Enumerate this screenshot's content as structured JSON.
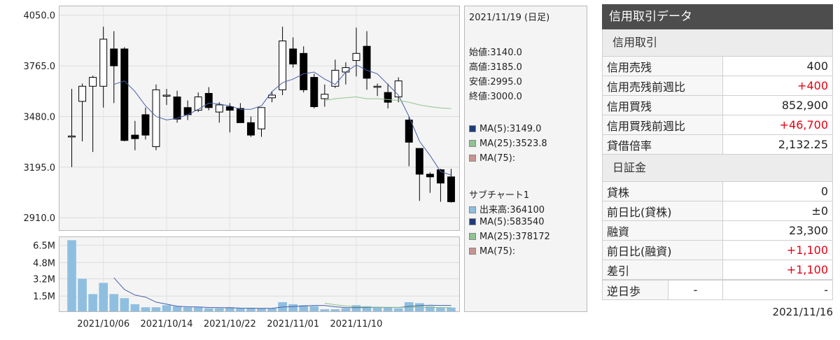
{
  "chart_data": [
    {
      "type": "candlestick",
      "panel": "price",
      "ylim": [
        2840,
        4100
      ],
      "yticks": [
        2910.0,
        3195.0,
        3480.0,
        3765.0,
        4050.0
      ],
      "ytick_labels": [
        "2910.0",
        "3195.0",
        "3480.0",
        "3765.0",
        "4050.0"
      ],
      "x_labels": [
        "2021/10/06",
        "2021/10/14",
        "2021/10/22",
        "2021/11/01",
        "2021/11/10"
      ],
      "x_label_indices": [
        3,
        9,
        15,
        21,
        27
      ],
      "candles": [
        {
          "o": 3370,
          "h": 3635,
          "l": 3195,
          "c": 3370
        },
        {
          "o": 3565,
          "h": 3665,
          "l": 3340,
          "c": 3650
        },
        {
          "o": 3650,
          "h": 3710,
          "l": 3280,
          "c": 3700
        },
        {
          "o": 3650,
          "h": 3985,
          "l": 3530,
          "c": 3915
        },
        {
          "o": 3860,
          "h": 3960,
          "l": 3555,
          "c": 3765
        },
        {
          "o": 3860,
          "h": 3870,
          "l": 3340,
          "c": 3345
        },
        {
          "o": 3375,
          "h": 3455,
          "l": 3290,
          "c": 3355
        },
        {
          "o": 3490,
          "h": 3530,
          "l": 3350,
          "c": 3375
        },
        {
          "o": 3310,
          "h": 3660,
          "l": 3290,
          "c": 3630
        },
        {
          "o": 3600,
          "h": 3635,
          "l": 3545,
          "c": 3600
        },
        {
          "o": 3590,
          "h": 3625,
          "l": 3445,
          "c": 3465
        },
        {
          "o": 3530,
          "h": 3570,
          "l": 3460,
          "c": 3490
        },
        {
          "o": 3515,
          "h": 3615,
          "l": 3505,
          "c": 3590
        },
        {
          "o": 3610,
          "h": 3645,
          "l": 3515,
          "c": 3530
        },
        {
          "o": 3505,
          "h": 3560,
          "l": 3445,
          "c": 3545
        },
        {
          "o": 3535,
          "h": 3555,
          "l": 3390,
          "c": 3515
        },
        {
          "o": 3525,
          "h": 3555,
          "l": 3450,
          "c": 3445
        },
        {
          "o": 3445,
          "h": 3480,
          "l": 3365,
          "c": 3375
        },
        {
          "o": 3410,
          "h": 3490,
          "l": 3365,
          "c": 3530
        },
        {
          "o": 3585,
          "h": 3620,
          "l": 3560,
          "c": 3600
        },
        {
          "o": 3630,
          "h": 3985,
          "l": 3600,
          "c": 3905
        },
        {
          "o": 3860,
          "h": 3925,
          "l": 3755,
          "c": 3775
        },
        {
          "o": 3835,
          "h": 3875,
          "l": 3615,
          "c": 3630
        },
        {
          "o": 3700,
          "h": 3720,
          "l": 3525,
          "c": 3535
        },
        {
          "o": 3580,
          "h": 3660,
          "l": 3535,
          "c": 3605
        },
        {
          "o": 3650,
          "h": 3800,
          "l": 3640,
          "c": 3740
        },
        {
          "o": 3730,
          "h": 3785,
          "l": 3660,
          "c": 3755
        },
        {
          "o": 3795,
          "h": 3980,
          "l": 3705,
          "c": 3835
        },
        {
          "o": 3875,
          "h": 3960,
          "l": 3630,
          "c": 3695
        },
        {
          "o": 3650,
          "h": 3665,
          "l": 3595,
          "c": 3650
        },
        {
          "o": 3615,
          "h": 3665,
          "l": 3525,
          "c": 3560
        },
        {
          "o": 3590,
          "h": 3700,
          "l": 3560,
          "c": 3680
        },
        {
          "o": 3460,
          "h": 3480,
          "l": 3200,
          "c": 3335
        },
        {
          "o": 3300,
          "h": 3300,
          "l": 3005,
          "c": 3155
        },
        {
          "o": 3155,
          "h": 3165,
          "l": 3050,
          "c": 3140
        },
        {
          "o": 3180,
          "h": 3185,
          "l": 3000,
          "c": 3105
        },
        {
          "o": 3140,
          "h": 3185,
          "l": 2995,
          "c": 3000
        }
      ],
      "ma5": [
        null,
        null,
        null,
        null,
        3660,
        3680,
        3620,
        3540,
        3480,
        3460,
        3470,
        3490,
        3520,
        3555,
        3550,
        3540,
        3520,
        3520,
        3540,
        3620,
        3670,
        3690,
        3720,
        3730,
        3690,
        3660,
        3730,
        3770,
        3740,
        3720,
        3660,
        3600,
        3480,
        3340,
        3260,
        3170,
        3150
      ],
      "ma25": [
        null,
        null,
        null,
        null,
        null,
        null,
        null,
        null,
        null,
        null,
        null,
        null,
        null,
        null,
        null,
        null,
        null,
        null,
        null,
        null,
        null,
        null,
        null,
        null,
        3570,
        3580,
        3585,
        3590,
        3580,
        3580,
        3575,
        3570,
        3560,
        3545,
        3535,
        3528,
        3524
      ],
      "legend": [
        {
          "label": "MA(5):3149.0",
          "color": "#1f3b7a"
        },
        {
          "label": "MA(25):3523.8",
          "color": "#8fc490"
        },
        {
          "label": "MA(75):",
          "color": "#c89390"
        }
      ]
    },
    {
      "type": "bar",
      "panel": "volume",
      "ylim": [
        0,
        7300000
      ],
      "yticks": [
        1500000,
        3200000,
        4800000,
        6500000
      ],
      "ytick_labels": [
        "1.5M",
        "3.2M",
        "4.8M",
        "6.5M"
      ],
      "values": [
        7000000,
        3200000,
        1700000,
        2800000,
        1700000,
        1300000,
        700000,
        400000,
        400000,
        600000,
        500000,
        400000,
        400000,
        300000,
        300000,
        400000,
        300000,
        300000,
        300000,
        300000,
        900000,
        700000,
        600000,
        500000,
        200000,
        200000,
        300000,
        600000,
        500000,
        400000,
        400000,
        300000,
        900000,
        800000,
        500000,
        400000,
        364100
      ],
      "ma5": [
        null,
        null,
        null,
        null,
        3300000,
        2150000,
        1600000,
        1400000,
        900000,
        700000,
        500000,
        450000,
        430000,
        380000,
        360000,
        350000,
        320000,
        310000,
        290000,
        300000,
        420000,
        470000,
        520000,
        580000,
        580000,
        450000,
        360000,
        360000,
        370000,
        390000,
        380000,
        380000,
        480000,
        560000,
        600000,
        580000,
        583540
      ],
      "ma25": [
        null,
        null,
        null,
        null,
        null,
        null,
        null,
        null,
        null,
        null,
        null,
        null,
        null,
        null,
        null,
        null,
        null,
        null,
        null,
        null,
        null,
        null,
        null,
        null,
        800000,
        650000,
        520000,
        450000,
        420000,
        400000,
        390000,
        385000,
        385000,
        382000,
        380000,
        379000,
        378172
      ],
      "title": "サブチャート1",
      "legend": [
        {
          "label": "出来高:364100",
          "color": "#8fbfe0"
        },
        {
          "label": "MA(5):583540",
          "color": "#1f3b7a"
        },
        {
          "label": "MA(25):378172",
          "color": "#8fc490"
        },
        {
          "label": "MA(75):",
          "color": "#c89390"
        }
      ]
    }
  ],
  "info": {
    "date": "2021/11/19 (日足)",
    "open": "始値:3140.0",
    "high": "高値:3185.0",
    "low": "安値:2995.0",
    "close": "終値:3000.0"
  },
  "colors": {
    "bull": "#ffffff",
    "bear": "#000000",
    "ma5": "#4a5fa8",
    "ma25": "#8fc490",
    "volume": "#8fbfe0"
  },
  "credit": {
    "title": "信用取引データ",
    "section1": "信用取引",
    "rows1": [
      {
        "label": "信用売残",
        "value": "400",
        "red": false
      },
      {
        "label": "信用売残前週比",
        "value": "+400",
        "red": true
      },
      {
        "label": "信用買残",
        "value": "852,900",
        "red": false
      },
      {
        "label": "信用買残前週比",
        "value": "+46,700",
        "red": true
      },
      {
        "label": "貸借倍率",
        "value": "2,132.25",
        "red": false
      }
    ],
    "section2": "日証金",
    "rows2": [
      {
        "label": "貸株",
        "value": "0",
        "red": false
      },
      {
        "label": "前日比(貸株)",
        "value": "±0",
        "red": false
      },
      {
        "label": "融資",
        "value": "23,300",
        "red": false
      },
      {
        "label": "前日比(融資)",
        "value": "+1,100",
        "red": true
      },
      {
        "label": "差引",
        "value": "+1,100",
        "red": true
      }
    ],
    "gyakuhibu": {
      "label": "逆日歩",
      "mid": "-",
      "value": "-"
    },
    "date": "2021/11/16"
  }
}
